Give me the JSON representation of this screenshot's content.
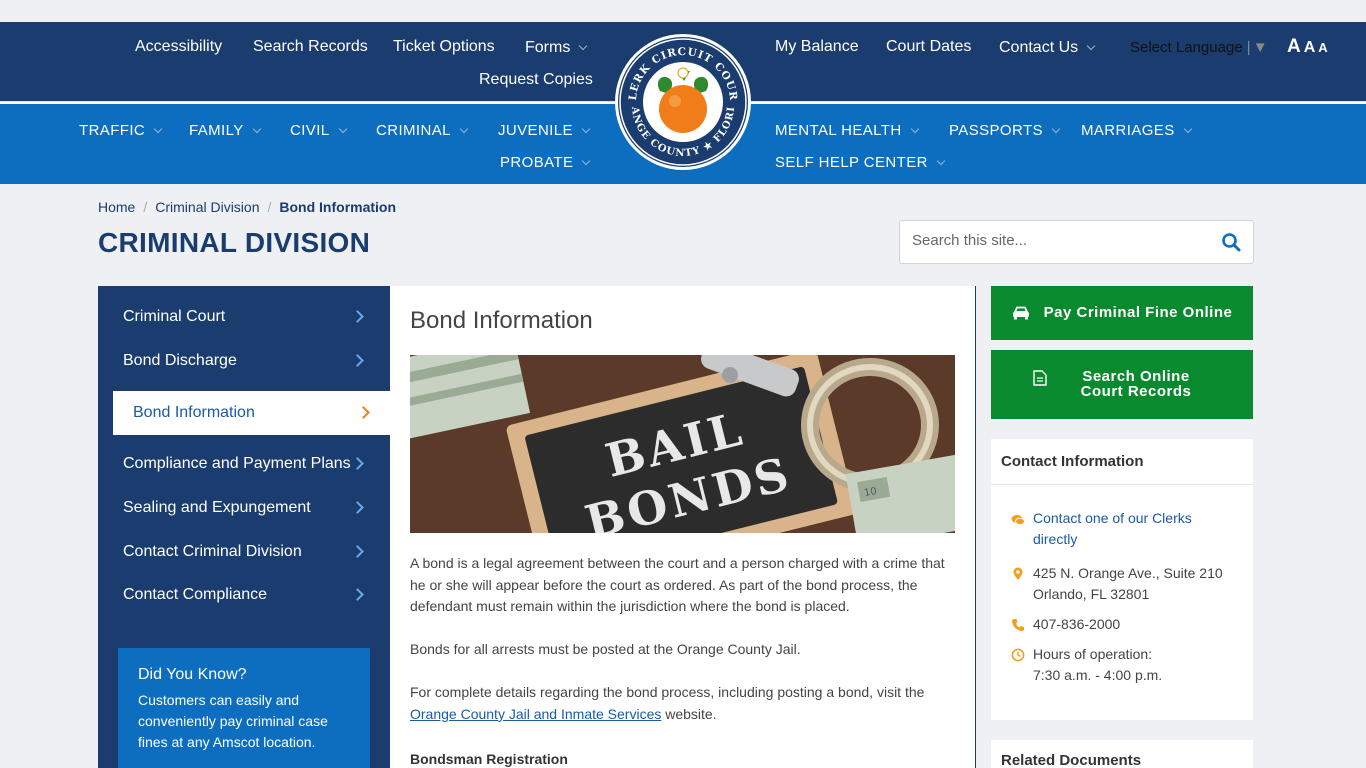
{
  "header": {
    "top_left_nav": [
      "Accessibility",
      "Search Records",
      "Ticket Options",
      "Forms",
      "Request Copies"
    ],
    "top_right_nav": [
      "My Balance",
      "Court Dates",
      "Contact Us"
    ],
    "language_label": "Select Language",
    "text_size": [
      "A",
      "A",
      "A"
    ],
    "main_nav_left": [
      "TRAFFIC",
      "FAMILY",
      "CIVIL",
      "CRIMINAL",
      "JUVENILE",
      "PROBATE"
    ],
    "main_nav_right": [
      "MENTAL HEALTH",
      "PASSPORTS",
      "MARRIAGES",
      "SELF HELP CENTER"
    ],
    "seal": {
      "top_text": "CLERK CIRCUIT COURT",
      "bottom_text": "ORANGE COUNTY ★ FLORIDA"
    }
  },
  "breadcrumb": {
    "home": "Home",
    "section": "Criminal Division",
    "current": "Bond Information"
  },
  "page_title": "CRIMINAL DIVISION",
  "search": {
    "placeholder": "Search this site..."
  },
  "sidebar": {
    "items": [
      {
        "label": "Criminal Court"
      },
      {
        "label": "Bond Discharge"
      },
      {
        "label": "Bond Information"
      },
      {
        "label": "Compliance and Payment Plans"
      },
      {
        "label": "Sealing and Expungement"
      },
      {
        "label": "Contact Criminal Division"
      },
      {
        "label": "Contact Compliance"
      }
    ],
    "did_you_know": {
      "title": "Did You Know?",
      "text": "Customers can easily and conveniently pay criminal case fines at any Amscot location."
    }
  },
  "content": {
    "title": "Bond Information",
    "hero_text": [
      "BAIL",
      "BONDS"
    ],
    "p1": "A bond is a legal agreement between the court and a person charged with a crime that he or she will appear before the court as ordered. As part of the bond process, the defendant must remain within the jurisdiction where the bond is placed.",
    "p2": "Bonds for all arrests must be posted at the Orange County Jail.",
    "p3_pre": "For complete details regarding the bond process, including posting a bond, visit the ",
    "p3_link": "Orange County Jail and Inmate Services",
    "p3_post": " website.",
    "subheading": "Bondsman Registration"
  },
  "right": {
    "pay_button": "Pay Criminal Fine Online",
    "search_button": "Search Online Court Records",
    "contact": {
      "title": "Contact Information",
      "link": "Contact one of our Clerks directly",
      "address1": "425 N. Orange Ave., Suite 210",
      "address2": "Orlando, FL 32801",
      "phone": "407-836-2000",
      "hours_label": "Hours of operation:",
      "hours": "7:30 a.m. - 4:00 p.m."
    },
    "related_title": "Related Documents"
  },
  "colors": {
    "navy": "#1a3c6e",
    "blue": "#0d6ebf",
    "green": "#0a8a2e",
    "orange": "#f07d1a"
  }
}
